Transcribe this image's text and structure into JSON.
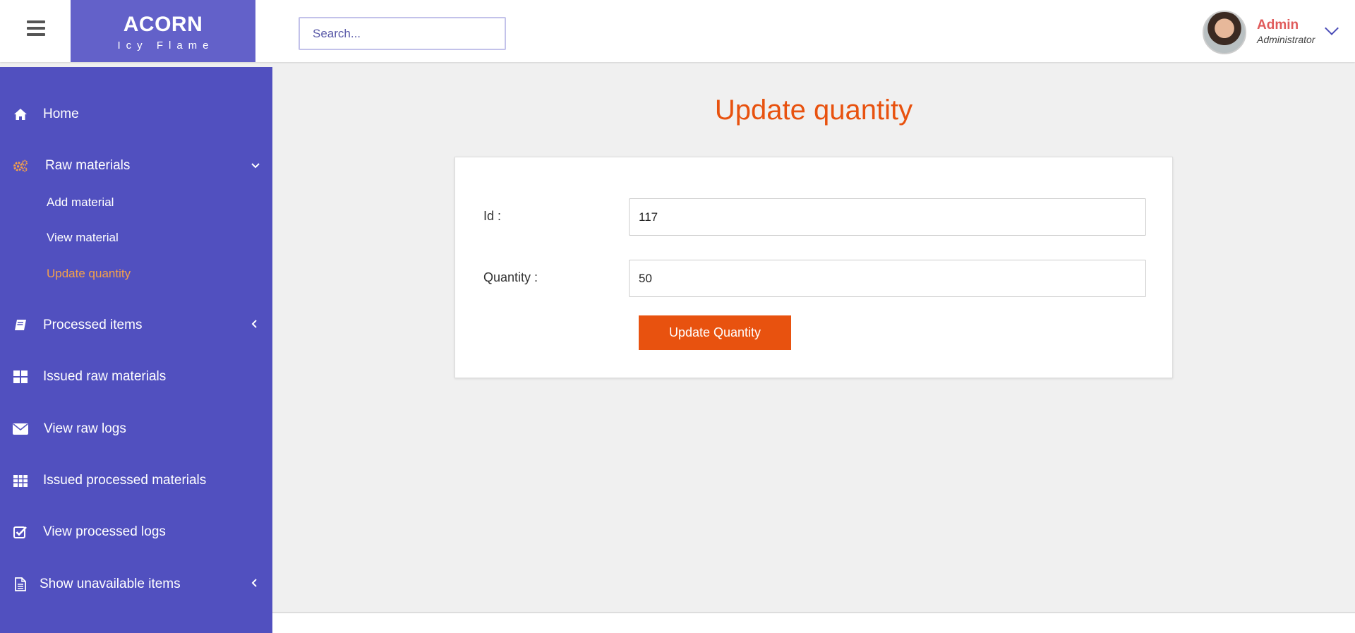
{
  "header": {
    "brand_name": "ACORN",
    "brand_tagline": "Icy Flame",
    "search_placeholder": "Search...",
    "user_name": "Admin",
    "user_role": "Administrator"
  },
  "sidebar": {
    "items": [
      {
        "label": "Home",
        "icon": "home-icon"
      },
      {
        "label": "Raw materials",
        "icon": "gears-icon",
        "expanded": true,
        "subitems": [
          {
            "label": "Add material"
          },
          {
            "label": "View material"
          },
          {
            "label": "Update quantity",
            "active": true
          }
        ]
      },
      {
        "label": "Processed items",
        "icon": "book-icon"
      },
      {
        "label": "Issued raw materials",
        "icon": "grid-icon"
      },
      {
        "label": "View raw logs",
        "icon": "envelope-icon"
      },
      {
        "label": "Issued processed materials",
        "icon": "table-icon"
      },
      {
        "label": "View processed logs",
        "icon": "checkbox-icon"
      },
      {
        "label": "Show unavailable items",
        "icon": "document-icon"
      }
    ]
  },
  "main": {
    "title": "Update quantity",
    "form": {
      "id_label": "Id :",
      "id_value": "117",
      "quantity_label": "Quantity :",
      "quantity_value": "50",
      "submit_label": "Update Quantity"
    }
  },
  "colors": {
    "accent": "#e8520f",
    "sidebar": "#5150bf",
    "brand": "#6361c9",
    "active_sub": "#f5a14a"
  }
}
